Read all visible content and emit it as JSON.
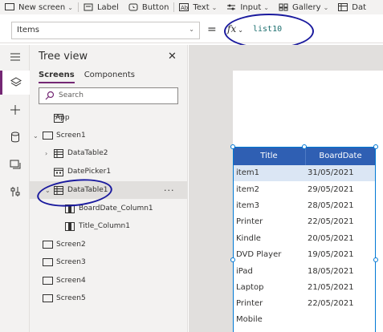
{
  "ribbon": {
    "new_screen": "New screen",
    "label": "Label",
    "button": "Button",
    "text": "Text",
    "input": "Input",
    "gallery": "Gallery",
    "data": "Dat"
  },
  "formula_bar": {
    "property": "Items",
    "equals": "=",
    "fx": "fx",
    "formula": "list10"
  },
  "tree": {
    "title": "Tree view",
    "tabs": [
      "Screens",
      "Components"
    ],
    "search_placeholder": "Search",
    "items": [
      {
        "label": "App"
      },
      {
        "label": "Screen1"
      },
      {
        "label": "DataTable2"
      },
      {
        "label": "DatePicker1"
      },
      {
        "label": "DataTable1"
      },
      {
        "label": "BoardDate_Column1"
      },
      {
        "label": "Title_Column1"
      },
      {
        "label": "Screen2"
      },
      {
        "label": "Screen3"
      },
      {
        "label": "Screen4"
      },
      {
        "label": "Screen5"
      }
    ],
    "more": "···"
  },
  "table": {
    "headers": [
      "Title",
      "BoardDate"
    ],
    "rows": [
      {
        "title": "item1",
        "date": "31/05/2021"
      },
      {
        "title": "item2",
        "date": "29/05/2021"
      },
      {
        "title": "item3",
        "date": "28/05/2021"
      },
      {
        "title": "Printer",
        "date": "22/05/2021"
      },
      {
        "title": "Kindle",
        "date": "20/05/2021"
      },
      {
        "title": "DVD Player",
        "date": "19/05/2021"
      },
      {
        "title": "iPad",
        "date": "18/05/2021"
      },
      {
        "title": "Laptop",
        "date": "21/05/2021"
      },
      {
        "title": "Printer",
        "date": "22/05/2021"
      },
      {
        "title": "Mobile",
        "date": ""
      }
    ]
  },
  "colors": {
    "accent": "#742774",
    "header": "#2f5fb3",
    "selected_row": "#dbe6f4",
    "annotation": "#1a1a9e"
  }
}
